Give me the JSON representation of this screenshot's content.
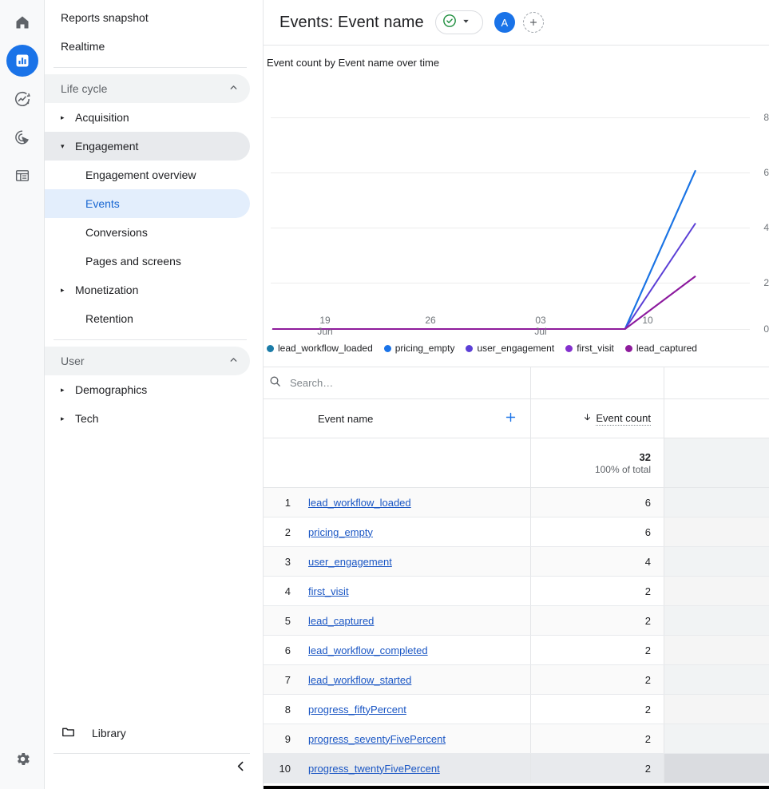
{
  "rail": {
    "icons": [
      {
        "name": "home-icon",
        "label": "Home",
        "active": false
      },
      {
        "name": "reports-bar-chart-icon",
        "label": "Reports",
        "active": true
      },
      {
        "name": "explore-trend-icon",
        "label": "Explore",
        "active": false
      },
      {
        "name": "advertising-target-icon",
        "label": "Advertising",
        "active": false
      },
      {
        "name": "configure-list-icon",
        "label": "Configure",
        "active": false
      }
    ],
    "settings": {
      "name": "gear-icon",
      "label": "Admin"
    }
  },
  "sidebar": {
    "top_items": [
      {
        "label": "Reports snapshot"
      },
      {
        "label": "Realtime"
      }
    ],
    "groups": [
      {
        "label": "Life cycle",
        "expanded": true,
        "items": [
          {
            "label": "Acquisition",
            "expandable": true,
            "expanded": false,
            "selected": false
          },
          {
            "label": "Engagement",
            "expandable": true,
            "expanded": true,
            "selected": false
          },
          {
            "label": "Engagement overview",
            "sub": true,
            "selected": false
          },
          {
            "label": "Events",
            "sub": true,
            "selected": true
          },
          {
            "label": "Conversions",
            "sub": true,
            "selected": false
          },
          {
            "label": "Pages and screens",
            "sub": true,
            "selected": false
          },
          {
            "label": "Monetization",
            "expandable": true,
            "expanded": false,
            "selected": false
          },
          {
            "label": "Retention",
            "expandable": false,
            "selected": false
          }
        ]
      },
      {
        "label": "User",
        "expanded": true,
        "items": [
          {
            "label": "Demographics",
            "expandable": true,
            "expanded": false,
            "selected": false
          },
          {
            "label": "Tech",
            "expandable": true,
            "expanded": false,
            "selected": false
          }
        ]
      }
    ],
    "library": {
      "label": "Library",
      "icon": "folder-icon"
    },
    "collapse": {
      "label": "Collapse navigation",
      "icon": "chevron-left-icon"
    }
  },
  "header": {
    "title": "Events: Event name",
    "status_icon": "check-circle-icon",
    "status_color": "#1e8e3e",
    "dropdown_icon": "chevron-down-icon",
    "avatar_letter": "A",
    "avatar_color": "#1a73e8",
    "add_icon": "plus-icon"
  },
  "chart_data": {
    "type": "line",
    "title": "Event count by Event name over time",
    "xlabel": "",
    "ylabel": "",
    "ylim": [
      0,
      8
    ],
    "yticks": [
      0,
      2,
      4,
      6,
      8
    ],
    "grid": true,
    "legend_position": "bottom",
    "xtick_labels": [
      {
        "top": "19",
        "bottom": "Jun"
      },
      {
        "top": "26",
        "bottom": ""
      },
      {
        "top": "03",
        "bottom": "Jul"
      },
      {
        "top": "10",
        "bottom": ""
      }
    ],
    "x": [
      "Jun 15",
      "Jun 19",
      "Jun 26",
      "Jul 03",
      "Jul 10",
      "Jul 13",
      "Jul 14"
    ],
    "series": [
      {
        "name": "lead_workflow_loaded",
        "color": "#1b7ca8",
        "values": [
          0,
          0,
          0,
          0,
          0,
          0,
          6
        ]
      },
      {
        "name": "pricing_empty",
        "color": "#1a73e8",
        "values": [
          0,
          0,
          0,
          0,
          0,
          0,
          6
        ]
      },
      {
        "name": "user_engagement",
        "color": "#5b3fd6",
        "values": [
          0,
          0,
          0,
          0,
          0,
          0,
          4
        ]
      },
      {
        "name": "first_visit",
        "color": "#8430ce",
        "values": [
          0,
          0,
          0,
          0,
          0,
          0,
          2
        ]
      },
      {
        "name": "lead_captured",
        "color": "#8e1b9c",
        "values": [
          0,
          0,
          0,
          0,
          0,
          0,
          2
        ]
      }
    ]
  },
  "table": {
    "search_placeholder": "Search…",
    "search_value": "",
    "search_icon": "search-icon",
    "columns": {
      "dimension": "Event name",
      "add_dimension_icon": "plus-icon",
      "metric": "Event count",
      "sort_icon": "arrow-down-icon"
    },
    "totals": {
      "event_count": "32",
      "event_count_share": "100% of total"
    },
    "rows": [
      {
        "rank": "1",
        "event_name": "lead_workflow_loaded",
        "event_count": "6"
      },
      {
        "rank": "2",
        "event_name": "pricing_empty",
        "event_count": "6"
      },
      {
        "rank": "3",
        "event_name": "user_engagement",
        "event_count": "4"
      },
      {
        "rank": "4",
        "event_name": "first_visit",
        "event_count": "2"
      },
      {
        "rank": "5",
        "event_name": "lead_captured",
        "event_count": "2"
      },
      {
        "rank": "6",
        "event_name": "lead_workflow_completed",
        "event_count": "2"
      },
      {
        "rank": "7",
        "event_name": "lead_workflow_started",
        "event_count": "2"
      },
      {
        "rank": "8",
        "event_name": "progress_fiftyPercent",
        "event_count": "2"
      },
      {
        "rank": "9",
        "event_name": "progress_seventyFivePercent",
        "event_count": "2"
      },
      {
        "rank": "10",
        "event_name": "progress_twentyFivePercent",
        "event_count": "2"
      }
    ]
  }
}
